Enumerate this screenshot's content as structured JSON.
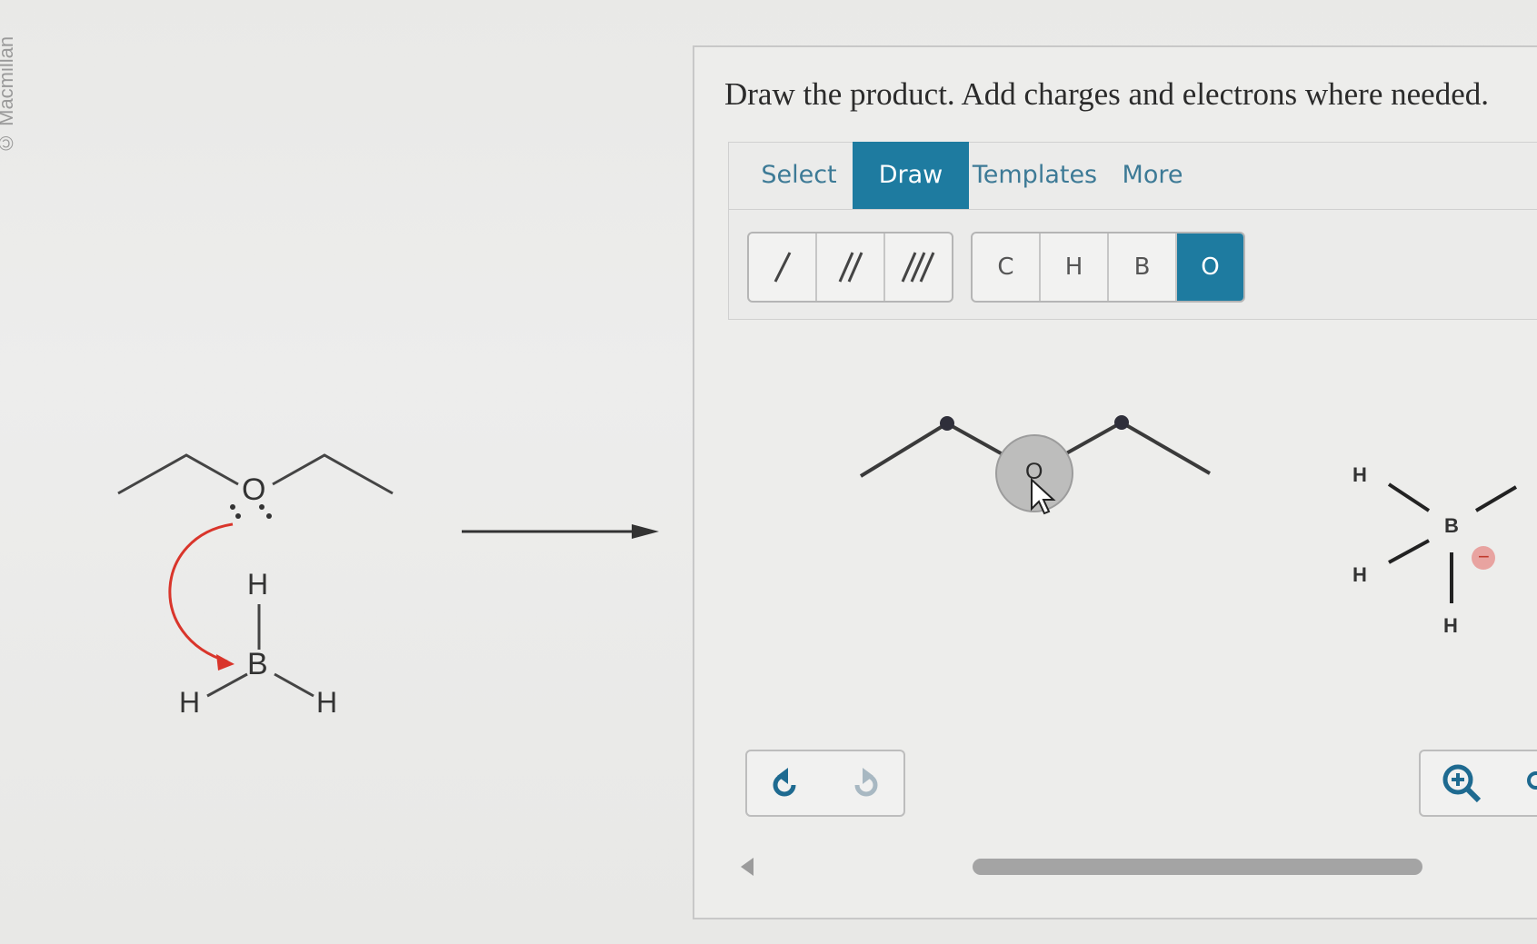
{
  "credit_text": "© Macmillan",
  "question": "Draw the product. Add charges and electrons where needed.",
  "tabs": [
    {
      "label": "Select"
    },
    {
      "label": "Draw"
    },
    {
      "label": "Templates"
    },
    {
      "label": "More"
    }
  ],
  "bond_tools": [
    {
      "icon": "single-bond-icon"
    },
    {
      "icon": "double-bond-icon"
    },
    {
      "icon": "triple-bond-icon"
    }
  ],
  "atom_tools": [
    {
      "label": "C"
    },
    {
      "label": "H"
    },
    {
      "label": "B"
    },
    {
      "label": "O"
    }
  ],
  "reactant": {
    "oxygen": "O",
    "boron": "B",
    "hydrogens": [
      "H",
      "H",
      "H"
    ],
    "arrow_color": "#d9352b"
  },
  "canvas": {
    "oxygen": "O",
    "boron": "B",
    "hydrogens": [
      "H",
      "H",
      "H"
    ],
    "charge": "−"
  },
  "accent_color": "#1e7ba0"
}
